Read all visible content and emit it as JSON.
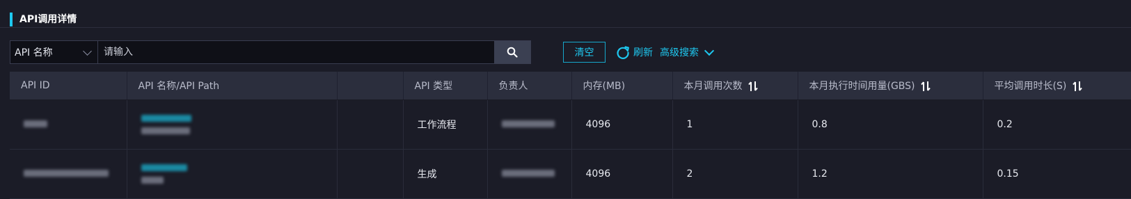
{
  "section": {
    "title": "API调用详情"
  },
  "search": {
    "field_label": "API 名称",
    "placeholder": "请输入"
  },
  "actions": {
    "clear": "清空",
    "refresh": "刷新",
    "advanced": "高级搜索"
  },
  "table": {
    "columns": [
      "API ID",
      "API 名称/API Path",
      "",
      "API 类型",
      "负责人",
      "内存(MB)",
      "本月调用次数",
      "本月执行时间用量(GBS)",
      "平均调用时长(S)"
    ],
    "rows": [
      {
        "type": "工作流程",
        "memory": "4096",
        "calls": "1",
        "gbs": "0.8",
        "avg": "0.2"
      },
      {
        "type": "生成",
        "memory": "4096",
        "calls": "2",
        "gbs": "1.2",
        "avg": "0.15"
      }
    ]
  },
  "colors": {
    "accent": "#1ec8f0",
    "background": "#1b1c27",
    "header_bg": "#2b2e3d"
  },
  "icons": [
    "search-icon",
    "refresh-icon",
    "chevron-down-icon",
    "sort-icon"
  ]
}
